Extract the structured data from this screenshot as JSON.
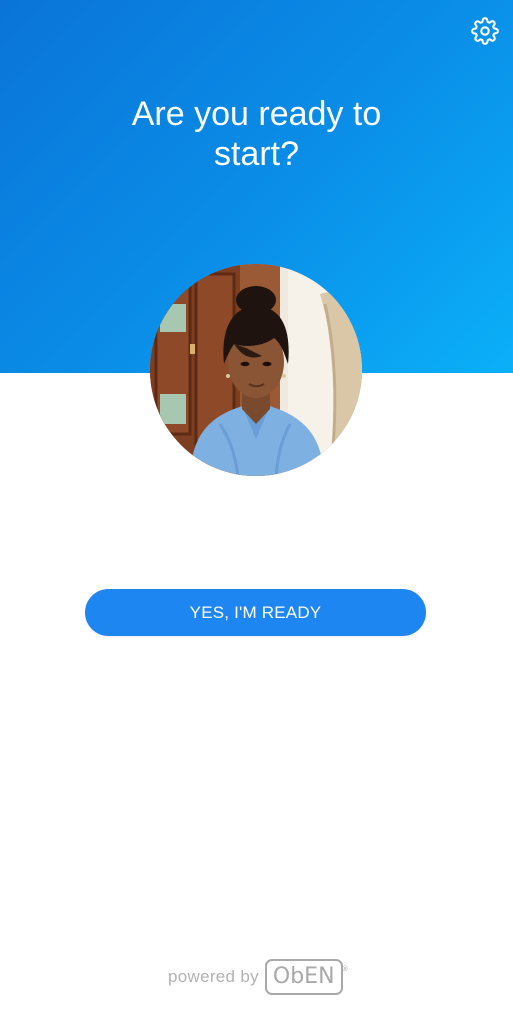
{
  "screen": {
    "title": "Are you ready to start?",
    "settings_icon": "gear-icon",
    "cta_label": "YES, I'M READY",
    "footer": {
      "powered_by": "powered by",
      "brand": "ObEN",
      "registered_mark": "®"
    }
  },
  "colors": {
    "header_gradient_start": "#0a74d8",
    "header_gradient_end": "#0bb0f9",
    "button": "#1e86f0",
    "button_text": "#ffffff",
    "footer_text": "#b2b2b2"
  }
}
